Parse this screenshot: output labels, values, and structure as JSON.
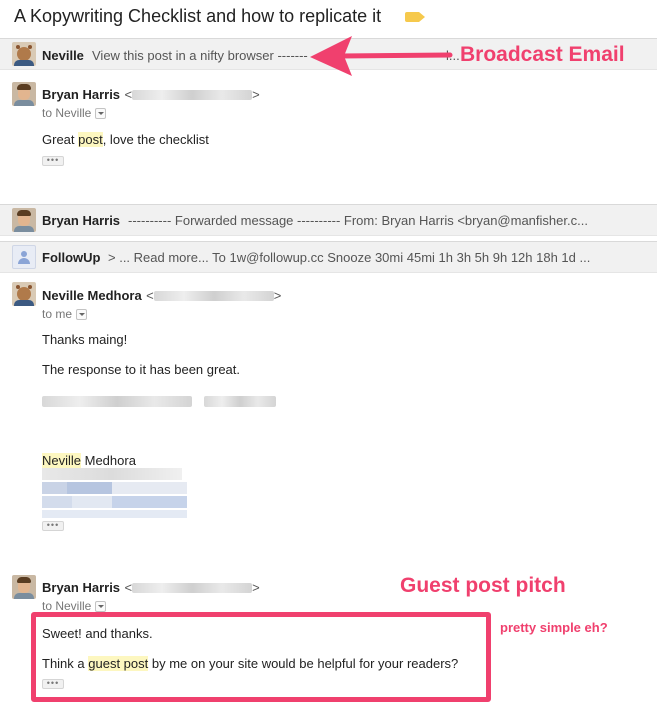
{
  "thread": {
    "subject": "A Kopywriting Checklist and how to replicate it"
  },
  "messages": [
    {
      "sender": "Neville",
      "snippet": "View this post in a nifty browser -------",
      "snippet_tail": "l...",
      "state": "collapsed"
    },
    {
      "sender": "Bryan Harris",
      "email_open": "<",
      "email_close": ">",
      "to_label": "to Neville",
      "body_pre": "Great ",
      "body_hl": "post",
      "body_post": ", love the checklist",
      "trim": "•••"
    },
    {
      "sender": "Bryan Harris",
      "snippet": "---------- Forwarded message ---------- From: Bryan Harris <bryan@manfisher.c...",
      "state": "collapsed"
    },
    {
      "sender": "FollowUp",
      "snippet": "> ... Read more... To 1w@followup.cc Snooze 30mi 45mi 1h 3h 5h 9h 12h 18h 1d ...",
      "state": "collapsed"
    },
    {
      "sender": "Neville Medhora",
      "email_open": "<",
      "email_close": ">",
      "to_label": "to me",
      "line1": "Thanks maing!",
      "line2": "The response to it has been great.",
      "sig_hl": "Neville",
      "sig_rest": " Medhora",
      "trim": "•••"
    },
    {
      "sender": "Bryan Harris",
      "email_open": "<",
      "email_close": ">",
      "to_label": "to Neville",
      "line1": "Sweet! and thanks.",
      "line2_pre": "Think a ",
      "line2_hl": "guest post",
      "line2_post": " by me on your site would be helpful for your readers?",
      "trim": "•••"
    }
  ],
  "annotations": {
    "broadcast": "Broadcast Email",
    "guest_pitch": "Guest post pitch",
    "simple": "pretty simple eh?"
  },
  "colors": {
    "annotation": "#f0406e",
    "highlight": "#fdf7c0",
    "label_tag": "#f6c94c"
  }
}
